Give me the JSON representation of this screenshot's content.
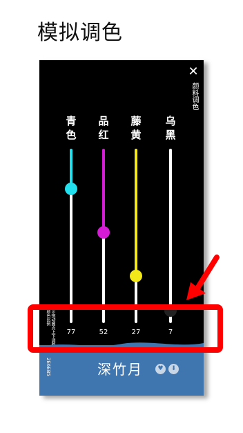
{
  "page_title": "模拟调色",
  "panel": {
    "title": "颜料调色",
    "close_icon": "close-icon",
    "hint": "可拖动圆点上下调整颜色比例",
    "columns": [
      {
        "label": "青色",
        "value": "77",
        "level": 0.77,
        "track_color": "#22e0ee",
        "knob_color": "#22e0ee"
      },
      {
        "label": "品红",
        "value": "52",
        "level": 0.52,
        "track_color": "#d61bd6",
        "knob_color": "#d61bd6"
      },
      {
        "label": "藤黄",
        "value": "27",
        "level": 0.27,
        "track_color": "#f2e81a",
        "knob_color": "#f2e81a"
      },
      {
        "label": "乌黑",
        "value": "7",
        "level": 0.07,
        "track_color": "#ffffff",
        "knob_color": "#222222"
      }
    ]
  },
  "result": {
    "name": "深竹月",
    "code": "2E6EB5",
    "background": "#3f76b0",
    "icons": [
      "heart-icon",
      "download-icon"
    ]
  },
  "annotation": {
    "color": "#ff0000"
  }
}
